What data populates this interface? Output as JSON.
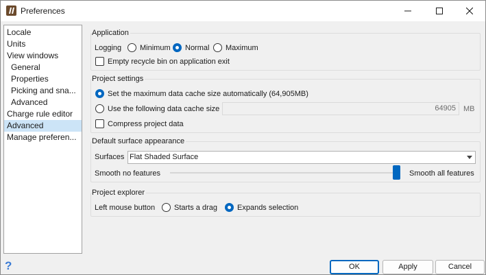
{
  "window": {
    "title": "Preferences",
    "icons": {
      "app": "app-logo-icon",
      "minimize": "minimize-icon",
      "maximize": "maximize-icon",
      "close": "close-icon",
      "help": "help-icon"
    }
  },
  "nav": {
    "items": [
      {
        "label": "Locale"
      },
      {
        "label": "Units"
      },
      {
        "label": "View windows"
      },
      {
        "label": "General"
      },
      {
        "label": "Properties"
      },
      {
        "label": "Picking and sna..."
      },
      {
        "label": "Advanced"
      },
      {
        "label": "Charge rule editor"
      },
      {
        "label": "Advanced"
      },
      {
        "label": "Manage preferen..."
      }
    ],
    "selected_index": 8
  },
  "application": {
    "title": "Application",
    "logging_label": "Logging",
    "logging_options": [
      "Minimum",
      "Normal",
      "Maximum"
    ],
    "logging_selected": "Normal",
    "empty_recycle_label": "Empty recycle bin on application exit",
    "empty_recycle_checked": false
  },
  "project_settings": {
    "title": "Project settings",
    "auto_cache_label": "Set the maximum data cache size automatically (64,905MB)",
    "manual_cache_label": "Use the following data cache size",
    "cache_mode_selected": "auto",
    "cache_value": "64905",
    "cache_unit": "MB",
    "compress_label": "Compress project data",
    "compress_checked": false
  },
  "surface": {
    "title": "Default surface appearance",
    "surfaces_label": "Surfaces",
    "surfaces_value": "Flat Shaded Surface",
    "smooth_min_label": "Smooth no features",
    "smooth_max_label": "Smooth all features",
    "smooth_level": 1.0
  },
  "explorer": {
    "title": "Project explorer",
    "left_mouse_label": "Left mouse button",
    "options": [
      "Starts a drag",
      "Expands selection"
    ],
    "selected": "Expands selection"
  },
  "buttons": {
    "ok": "OK",
    "apply": "Apply",
    "cancel": "Cancel"
  },
  "colors": {
    "accent": "#0067c0",
    "nav_selected": "#cce4f7"
  }
}
